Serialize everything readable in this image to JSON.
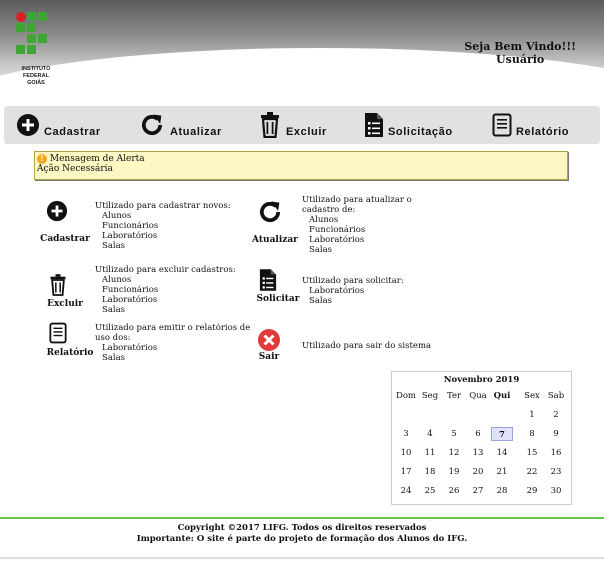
{
  "header": {
    "logo_text": [
      "INSTITUTO",
      "FEDERAL",
      "GOIÁS"
    ],
    "welcome_line1": "Seja Bem Vindo!!!",
    "welcome_line2": "Usuário"
  },
  "toolbar": {
    "items": [
      {
        "label": "Cadastrar",
        "icon": "plus-circle-icon"
      },
      {
        "label": "Atualizar",
        "icon": "refresh-icon"
      },
      {
        "label": "Excluir",
        "icon": "trash-icon"
      },
      {
        "label": "Solicitação",
        "icon": "clipboard-list-icon"
      },
      {
        "label": "Relatório",
        "icon": "report-icon"
      }
    ]
  },
  "alert": {
    "title": "Mensagem de Alerta",
    "message": "Ação Necessária",
    "color": "#fdf8c3"
  },
  "features": [
    {
      "label": "Cadastrar",
      "icon": "plus-circle-icon",
      "desc": "Utilizado para cadastrar novos:",
      "items": [
        "Alunos",
        "Funcionários",
        "Laboratórios",
        "Salas"
      ]
    },
    {
      "label": "Atualizar",
      "icon": "refresh-icon",
      "desc": "Utilizado para atualizar o cadastro de:",
      "items": [
        "Alunos",
        "Funcionários",
        "Laboratórios",
        "Salas"
      ]
    },
    {
      "label": "Excluir",
      "icon": "trash-icon",
      "desc": "Utilizado para excluir cadastros:",
      "items": [
        "Alunos",
        "Funcionários",
        "Laboratórios",
        "Salas"
      ]
    },
    {
      "label": "Solicitar",
      "icon": "clipboard-list-icon",
      "desc": "Utilizado para solicitar:",
      "items": [
        "Laboratórios",
        "Salas"
      ]
    },
    {
      "label": "Relatório",
      "icon": "report-icon",
      "desc": "Utilizado para emitir o relatórios de uso dos:",
      "items": [
        "Laboratórios",
        "Salas"
      ]
    },
    {
      "label": "Sair",
      "icon": "exit-icon",
      "desc": "Utilizado para sair do sistema",
      "items": []
    }
  ],
  "calendar": {
    "title": "Novembro 2019",
    "weekdays": [
      "Dom",
      "Seg",
      "Ter",
      "Qua",
      "Qui",
      "Sex",
      "Sab"
    ],
    "highlight_weekday": "Qui",
    "weeks": [
      [
        "",
        "",
        "",
        "",
        "",
        "1",
        "2"
      ],
      [
        "3",
        "4",
        "5",
        "6",
        "7",
        "8",
        "9"
      ],
      [
        "10",
        "11",
        "12",
        "13",
        "14",
        "15",
        "16"
      ],
      [
        "17",
        "18",
        "19",
        "20",
        "21",
        "22",
        "23"
      ],
      [
        "24",
        "25",
        "26",
        "27",
        "28",
        "29",
        "30"
      ]
    ],
    "today": "7"
  },
  "footer": {
    "line1": "Copyright ©2017 LIFG. Todos os direitos reservados",
    "line2": "Importante: O site é parte do projeto de formação dos Alunos do IFG."
  },
  "colors": {
    "accent_green": "#6cc24a",
    "logo_red": "#d62424",
    "logo_green": "#3fa535",
    "exit_red": "#e23a3a"
  }
}
